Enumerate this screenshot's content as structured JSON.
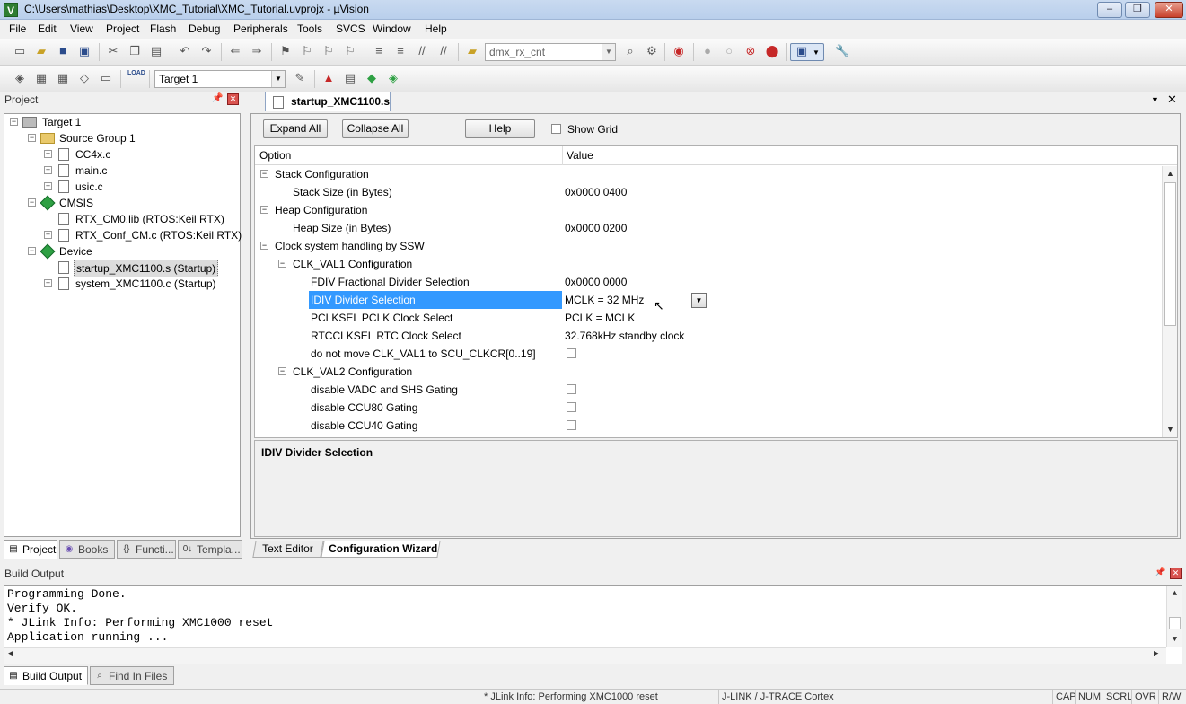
{
  "window": {
    "title": "C:\\Users\\mathias\\Desktop\\XMC_Tutorial\\XMC_Tutorial.uvprojx - µVision",
    "app_icon": "V",
    "minimize": "–",
    "maximize": "❐",
    "close": "✕"
  },
  "menu": [
    "File",
    "Edit",
    "View",
    "Project",
    "Flash",
    "Debug",
    "Peripherals",
    "Tools",
    "SVCS",
    "Window",
    "Help"
  ],
  "toolbar1": {
    "find_combo_value": "dmx_rx_cnt"
  },
  "toolbar2": {
    "target_combo_value": "Target 1",
    "load_label": "LOAD"
  },
  "project_panel": {
    "title": "Project",
    "tree": {
      "root": "Target 1",
      "group1": "Source Group 1",
      "file_cc4x": "CC4x.c",
      "file_main": "main.c",
      "file_usic": "usic.c",
      "cmsis": "CMSIS",
      "rtx_lib": "RTX_CM0.lib (RTOS:Keil RTX)",
      "rtx_conf": "RTX_Conf_CM.c (RTOS:Keil RTX)",
      "device": "Device",
      "startup": "startup_XMC1100.s (Startup)",
      "system": "system_XMC1100.c (Startup)"
    },
    "tabs": {
      "project": "Project",
      "books": "Books",
      "functions": "Functi...",
      "templates": "Templa..."
    }
  },
  "editor": {
    "tab_title": "startup_XMC1100.s",
    "buttons": {
      "expand_all": "Expand All",
      "collapse_all": "Collapse All",
      "help": "Help"
    },
    "show_grid_label": "Show Grid",
    "columns": {
      "option": "Option",
      "value": "Value"
    },
    "rows": {
      "stack_cfg": "Stack Configuration",
      "stack_size": "Stack Size (in Bytes)",
      "stack_size_val": "0x0000 0400",
      "heap_cfg": "Heap Configuration",
      "heap_size": "Heap Size (in Bytes)",
      "heap_size_val": "0x0000 0200",
      "clock_cfg": "Clock system handling by SSW",
      "clkval1": "CLK_VAL1 Configuration",
      "fdiv": "FDIV Fractional Divider Selection",
      "fdiv_val": "0x0000 0000",
      "idiv": "IDIV Divider Selection",
      "idiv_val": "MCLK = 32 MHz",
      "pclksel": "PCLKSEL PCLK Clock Select",
      "pclksel_val": "PCLK = MCLK",
      "rtcclksel": "RTCCLKSEL RTC Clock Select",
      "rtcclksel_val": "32.768kHz standby clock",
      "nomove": "do not move CLK_VAL1 to SCU_CLKCR[0..19]",
      "clkval2": "CLK_VAL2 Configuration",
      "vadc": "disable VADC and SHS Gating",
      "ccu80": "disable CCU80 Gating",
      "ccu40": "disable CCU40 Gating"
    },
    "description_title": "IDIV Divider Selection",
    "bottom_tabs": {
      "text_editor": "Text Editor",
      "config_wizard": "Configuration Wizard"
    }
  },
  "build_output": {
    "title": "Build Output",
    "lines": [
      "Programming Done.",
      "Verify OK.",
      "* JLink Info: Performing XMC1000 reset",
      "Application running ..."
    ],
    "tabs": {
      "build": "Build Output",
      "find": "Find In Files"
    }
  },
  "statusbar": {
    "message": "* JLink Info: Performing XMC1000 reset",
    "debugger": "J-LINK / J-TRACE Cortex",
    "cap": "CAP",
    "num": "NUM",
    "scrl": "SCRL",
    "ovr": "OVR",
    "rw": "R/W"
  }
}
